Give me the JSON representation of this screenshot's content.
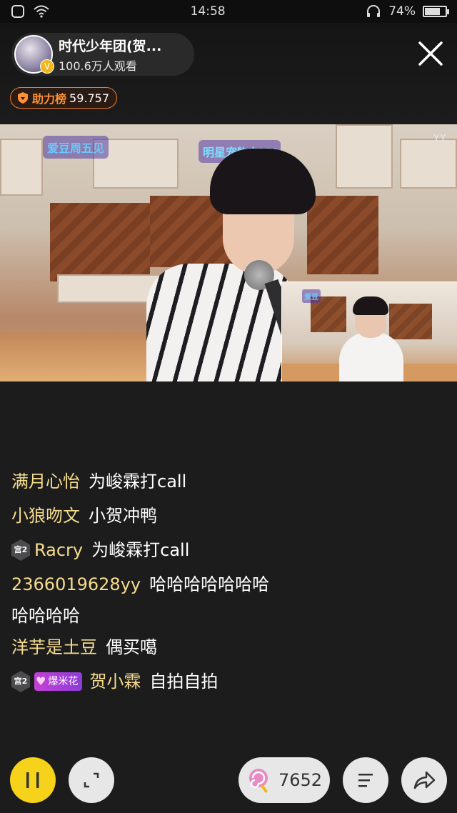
{
  "status_bar": {
    "time": "14:58",
    "battery": "74%",
    "battery_level": 0.74,
    "icons": [
      "notification-icon",
      "wifi-icon",
      "headphones-icon",
      "battery-icon"
    ]
  },
  "header": {
    "host_name": "时代少年团(贺...",
    "viewers": "100.6万人观看",
    "verified_mark": "V",
    "rank": {
      "label": "助力榜",
      "value": "59.757"
    }
  },
  "video": {
    "studio_logo_main": "爱豆周五见",
    "studio_logo_second": "明星宠物在YY",
    "watermark": "YY",
    "pip_logo": "爱豆"
  },
  "chat": {
    "messages": [
      {
        "user": "满月心怡",
        "text": "为峻霖打call"
      },
      {
        "user": "小狼吻文",
        "text": "小贺冲鸭"
      },
      {
        "badge": "宫2",
        "user": "Racry",
        "text": "为峻霖打call"
      },
      {
        "user": "2366019628yy",
        "text": "哈哈哈哈哈哈哈",
        "continuation": "哈哈哈哈"
      },
      {
        "user": "洋芋是土豆",
        "text": "偶买噶"
      },
      {
        "badge": "宫2",
        "gift_badge": "爆米花",
        "user": "贺小霖",
        "text": "自拍自拍"
      }
    ]
  },
  "bottom_bar": {
    "gift_count": "7652",
    "accent_color": "#f6d21a"
  }
}
